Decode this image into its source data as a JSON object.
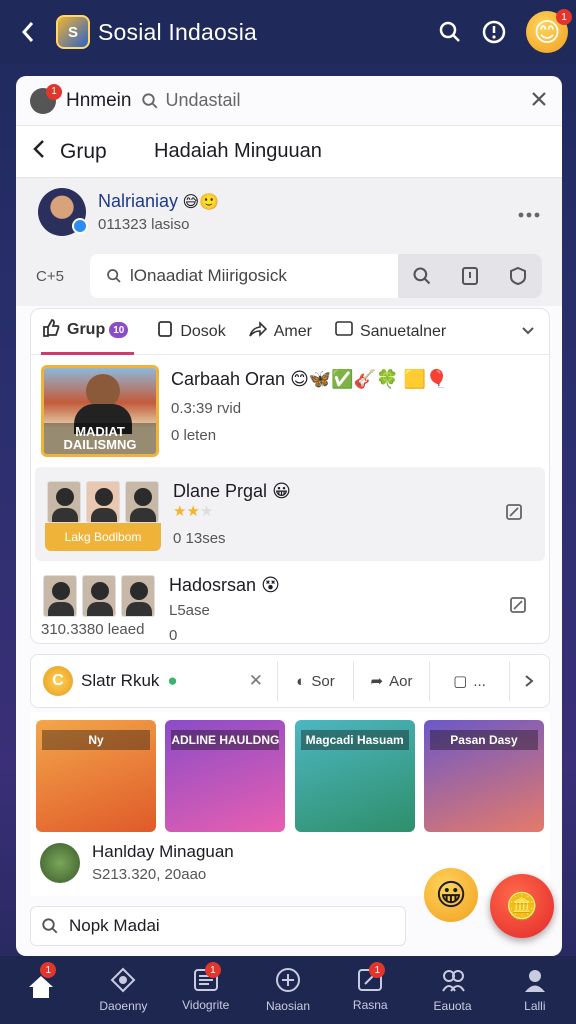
{
  "app": {
    "title": "Sosial Indaosia",
    "header_badge": "1"
  },
  "search_bar": {
    "user_name": "Hnmein",
    "query": "Undastail",
    "avatar_badge": "1"
  },
  "group_header": {
    "left": "Grup",
    "title": "Hadaiah Minguuan"
  },
  "user": {
    "name": "Nalrianiay",
    "subtitle": "011323 lasiso",
    "emoji": "😅🙂"
  },
  "toolbar": {
    "lead_label": "C+5",
    "search_text": "lOnaadiat Miirigosick"
  },
  "tabs": [
    {
      "label": "Grup",
      "badge": "10"
    },
    {
      "label": "Dosok"
    },
    {
      "label": "Amer"
    },
    {
      "label": "Sanuetalner"
    }
  ],
  "posts": [
    {
      "title": "Carbaah Oran",
      "meta": "0.3:39 rvid",
      "count": "0 leten",
      "caption": "MADIAT DAILISMNG",
      "emoji": "😊🦋✅🎸🍀 🟨🎈"
    },
    {
      "title": "Dlane Prgal",
      "count": "0 13ses",
      "caption": "Lakg Bodlbom",
      "emoji": "😀",
      "rating": 2
    },
    {
      "title": "Hadosrsan",
      "meta": "L5ase",
      "count": "0",
      "date": "310.3380 leaed",
      "emoji": "😵"
    }
  ],
  "shortcut_bar": {
    "label": "Slatr Rkuk",
    "seg1": "Sor",
    "seg2": "Aor",
    "seg3": "..."
  },
  "gallery": {
    "tiles": [
      "Ny",
      "ADLINE HAULDNG",
      "Magcadi Hasuam",
      "Pasan Dasy"
    ],
    "footer_title": "Hanlday Minaguan",
    "footer_meta": "S213.320, 20aao"
  },
  "bottom_search": {
    "text": "Nopk Madai"
  },
  "nav": [
    {
      "label": "",
      "badge": "1"
    },
    {
      "label": "Daoenny"
    },
    {
      "label": "Vidogrite",
      "badge": "1"
    },
    {
      "label": "Naosian"
    },
    {
      "label": "Rasna",
      "badge": "1"
    },
    {
      "label": "Eauota"
    },
    {
      "label": "Lalli"
    }
  ],
  "colors": {
    "header_bg": "#202a5a",
    "accent": "#d13a6b",
    "badge": "#e2352b",
    "coin": "#f0a020"
  }
}
